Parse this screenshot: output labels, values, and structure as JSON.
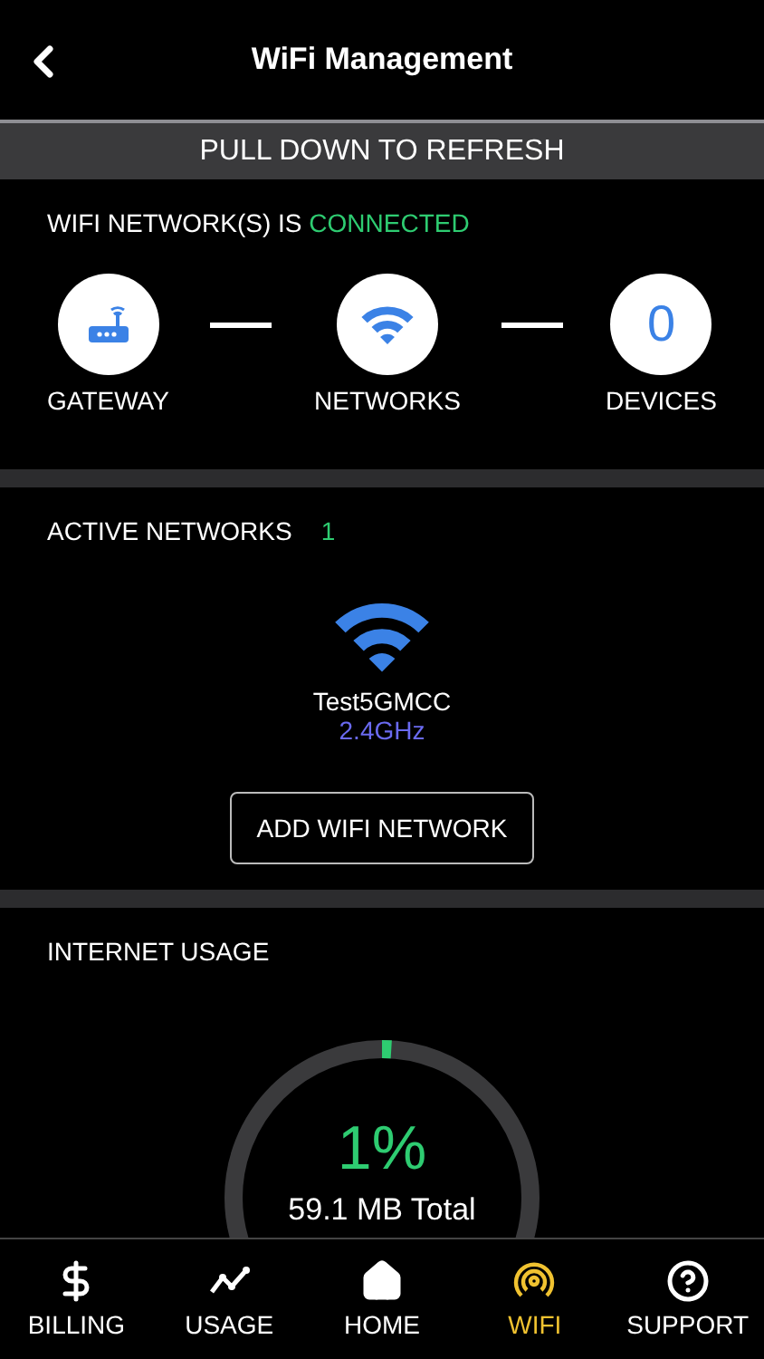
{
  "header": {
    "title": "WiFi Management"
  },
  "refresh_banner": "PULL DOWN TO REFRESH",
  "status": {
    "label": "WIFI NETWORK(S) IS",
    "state": "CONNECTED",
    "connected": true
  },
  "topology": [
    {
      "kind": "gateway",
      "label": "GATEWAY"
    },
    {
      "kind": "networks",
      "label": "NETWORKS"
    },
    {
      "kind": "devices",
      "value": "0",
      "label": "DEVICES"
    }
  ],
  "active_networks": {
    "title": "ACTIVE NETWORKS",
    "count": "1",
    "networks": [
      {
        "name": "Test5GMCC",
        "band": "2.4GHz"
      }
    ],
    "button": "ADD WIFI NETWORK"
  },
  "internet_usage": {
    "title": "INTERNET USAGE",
    "percent": "1%",
    "level": 0.01,
    "total": "59.1 MB Total"
  },
  "tab_bar": [
    {
      "kind": "billing",
      "label": "BILLING",
      "selected": false
    },
    {
      "kind": "usage",
      "label": "USAGE",
      "selected": false
    },
    {
      "kind": "home",
      "label": "HOME",
      "selected": false
    },
    {
      "kind": "wifi",
      "label": "WIFI",
      "selected": true
    },
    {
      "kind": "support",
      "label": "SUPPORT",
      "selected": false
    }
  ]
}
